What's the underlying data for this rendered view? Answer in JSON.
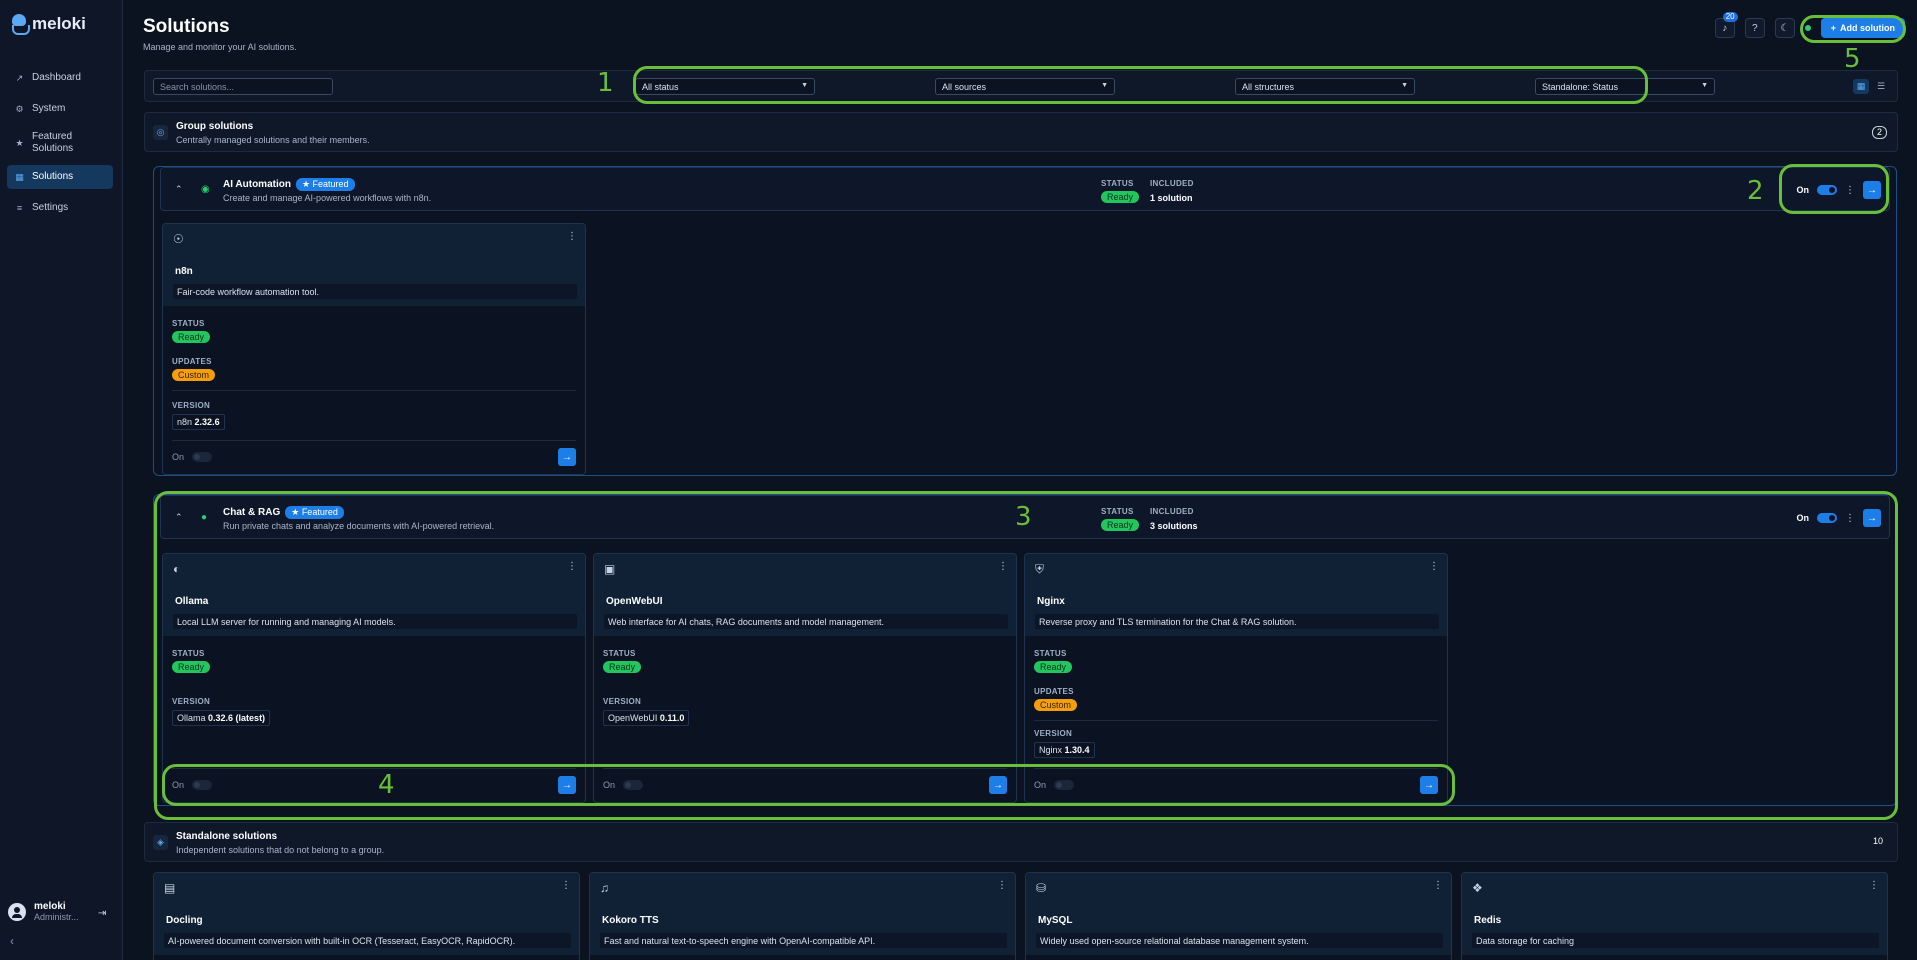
{
  "app": {
    "name": "meloki"
  },
  "sidebar": {
    "items": [
      {
        "label": "Dashboard",
        "icon": "chart-icon"
      },
      {
        "label": "System",
        "icon": "gear-icon"
      },
      {
        "label": "Featured Solutions",
        "icon": "star-icon"
      },
      {
        "label": "Solutions",
        "icon": "grid-icon",
        "active": true
      },
      {
        "label": "Settings",
        "icon": "sliders-icon"
      }
    ],
    "user": {
      "name": "meloki",
      "role": "Administr..."
    }
  },
  "header": {
    "title": "Solutions",
    "subtitle": "Manage and monitor your AI solutions.",
    "notification_count": "20",
    "add_label": "Add solution"
  },
  "annotations": [
    "1",
    "2",
    "3",
    "4",
    "5"
  ],
  "toolbar": {
    "search_placeholder": "Search solutions...",
    "filters": [
      "All status",
      "All sources",
      "All structures",
      "Standalone: Status"
    ]
  },
  "labels": {
    "status": "STATUS",
    "included": "INCLUDED",
    "updates": "UPDATES",
    "version": "VERSION",
    "on": "On",
    "featured": "Featured",
    "ready": "Ready",
    "custom": "Custom"
  },
  "group_section": {
    "title": "Group solutions",
    "subtitle": "Centrally managed solutions and their members.",
    "count": "2"
  },
  "groups": [
    {
      "title": "AI Automation",
      "subtitle": "Create and manage AI-powered workflows with n8n.",
      "status": "Ready",
      "included": "1 solution",
      "members": [
        {
          "name": "n8n",
          "desc": "Fair-code workflow automation tool.",
          "status": "Ready",
          "updates": "Custom",
          "version_name": "n8n",
          "version": "2.32.6"
        }
      ]
    },
    {
      "title": "Chat & RAG",
      "subtitle": "Run private chats and analyze documents with AI-powered retrieval.",
      "status": "Ready",
      "included": "3 solutions",
      "members": [
        {
          "name": "Ollama",
          "desc": "Local LLM server for running and managing AI models.",
          "status": "Ready",
          "version_name": "Ollama",
          "version": "0.32.6 (latest)"
        },
        {
          "name": "OpenWebUI",
          "desc": "Web interface for AI chats, RAG documents and model management.",
          "status": "Ready",
          "version_name": "OpenWebUI",
          "version": "0.11.0"
        },
        {
          "name": "Nginx",
          "desc": "Reverse proxy and TLS termination for the Chat & RAG solution.",
          "status": "Ready",
          "updates": "Custom",
          "version_name": "Nginx",
          "version": "1.30.4"
        }
      ]
    }
  ],
  "standalone_section": {
    "title": "Standalone solutions",
    "subtitle": "Independent solutions that do not belong to a group.",
    "count": "10"
  },
  "standalone": [
    {
      "name": "Docling",
      "desc": "AI-powered document conversion with built-in OCR (Tesseract, EasyOCR, RapidOCR).",
      "icon": "document-icon"
    },
    {
      "name": "Kokoro TTS",
      "desc": "Fast and natural text-to-speech engine with OpenAI-compatible API.",
      "icon": "speaker-icon"
    },
    {
      "name": "MySQL",
      "desc": "Widely used open-source relational database management system.",
      "icon": "database-icon"
    },
    {
      "name": "Redis",
      "desc": "Data storage for caching",
      "icon": "cubes-icon"
    }
  ]
}
